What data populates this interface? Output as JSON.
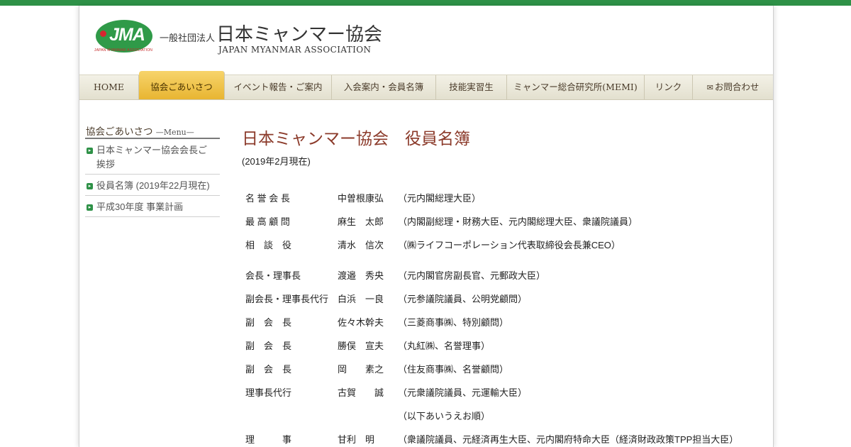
{
  "header": {
    "logo_text": "JMA",
    "logo_sub": "JAPAN MYANMAR ASSOCIATION",
    "org_type": "一般社団法人",
    "org_name": "日本ミャンマー協会",
    "org_name_en": "JAPAN MYANMAR ASSOCIATION"
  },
  "nav": [
    {
      "label": "HOME",
      "active": false
    },
    {
      "label": "協会ごあいさつ",
      "active": true
    },
    {
      "label": "イベント報告・ご案内",
      "active": false
    },
    {
      "label": "入会案内・会員名簿",
      "active": false
    },
    {
      "label": "技能実習生",
      "active": false
    },
    {
      "label": "ミャンマー総合研究所(MEMI)",
      "active": false
    },
    {
      "label": "リンク",
      "active": false
    },
    {
      "label": "お問合わせ",
      "active": false,
      "icon": "mail-icon"
    }
  ],
  "sidebar": {
    "title": "協会ごあいさつ",
    "title_sub": "—Menu—",
    "items": [
      {
        "label": "日本ミャンマー協会会長ご挨拶"
      },
      {
        "label": "役員名簿 (2019年22月現在)"
      },
      {
        "label": "平成30年度 事業計画"
      }
    ]
  },
  "main": {
    "title": "日本ミャンマー協会　役員名簿",
    "note": "(2019年2月現在)",
    "officers": [
      {
        "role": "名 誉 会 長",
        "name": "中曽根康弘",
        "note": "（元内閣総理大臣）"
      },
      {
        "role": "最 高 顧 問",
        "name": "麻生　太郎",
        "note": "（内閣副総理・財務大臣、元内閣総理大臣、衆議院議員）"
      },
      {
        "role": "相　談　役",
        "name": "清水　信次",
        "note": "（㈱ライフコーポレーション代表取締役会長兼CEO）"
      },
      {
        "role": "会長・理事長",
        "name": "渡邉　秀央",
        "note": "（元内閣官房副長官、元郵政大臣）"
      },
      {
        "role": "副会長・理事長代行",
        "name": "白浜　一良",
        "note": "（元参議院議員、公明党顧問）"
      },
      {
        "role": "副　会　長",
        "name": "佐々木幹夫",
        "note": "（三菱商事㈱、特別顧問）"
      },
      {
        "role": "副　会　長",
        "name": "勝俣　宣夫",
        "note": "（丸紅㈱、名誉理事）"
      },
      {
        "role": "副　会　長",
        "name": "岡　　素之",
        "note": "（住友商事㈱、名誉顧問）"
      },
      {
        "role": "理事長代行",
        "name": "古賀　　誠",
        "note": "（元衆議院議員、元運輸大臣）"
      },
      {
        "role": "",
        "name": "",
        "note": "（以下あいうえお順）"
      },
      {
        "role": "理　　　事",
        "name": "甘利　明",
        "note": "（衆議院議員、元経済再生大臣、元内閣府特命大臣（経済財政政策TPP担当大臣）"
      }
    ]
  }
}
